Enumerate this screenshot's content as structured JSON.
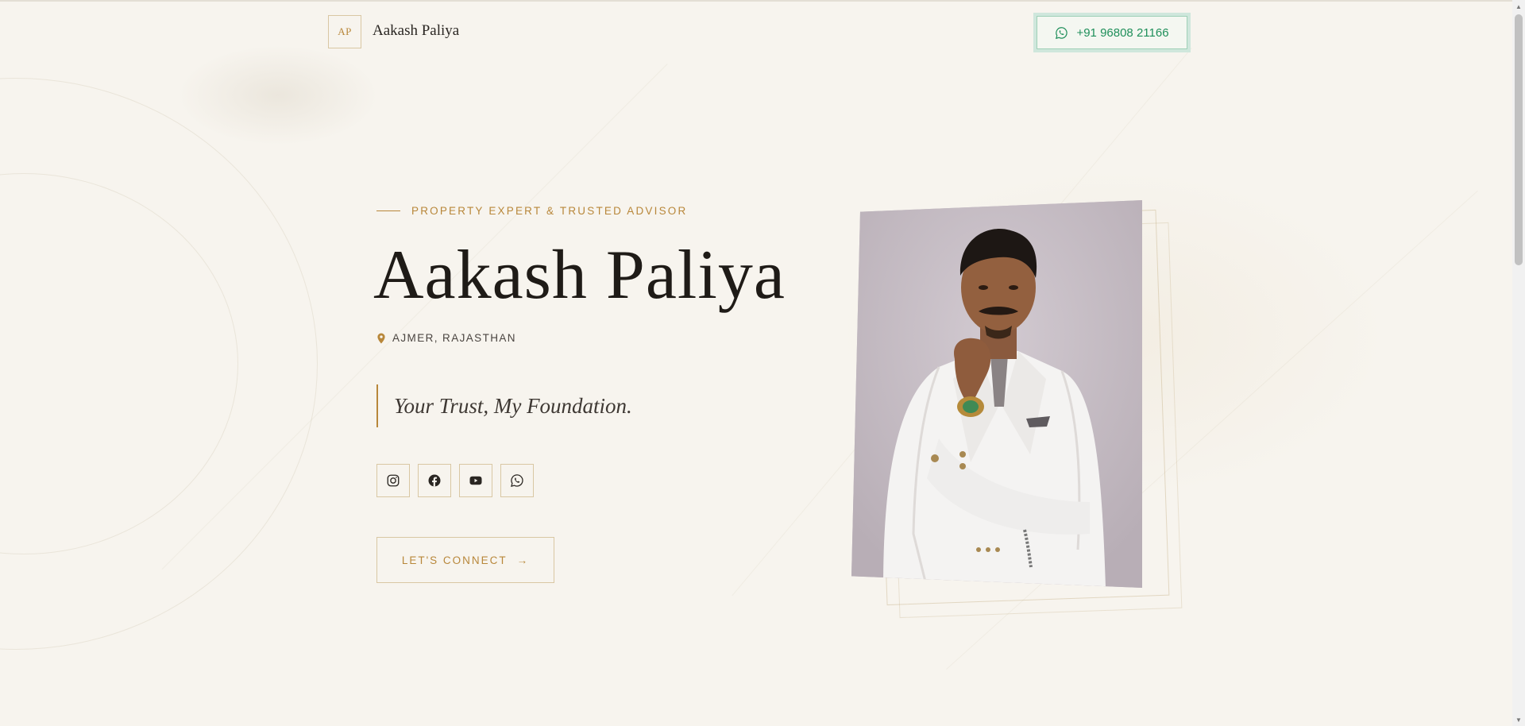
{
  "header": {
    "logo_initials": "AP",
    "logo_name": "Aakash Paliya",
    "phone_label": "+91 96808 21166"
  },
  "hero": {
    "eyebrow": "PROPERTY EXPERT & TRUSTED ADVISOR",
    "name": "Aakash Paliya",
    "location": "AJMER, RAJASTHAN",
    "tagline": "Your Trust, My Foundation.",
    "cta_label": "LET'S CONNECT",
    "cta_arrow": "→"
  },
  "socials": [
    {
      "icon": "instagram-icon"
    },
    {
      "icon": "facebook-icon"
    },
    {
      "icon": "youtube-icon"
    },
    {
      "icon": "whatsapp-icon"
    }
  ],
  "colors": {
    "background": "#f7f4ee",
    "accent_gold": "#b8873a",
    "whatsapp_green": "#1f8f5a",
    "text_dark": "#1f1b17"
  },
  "scrollbar": {
    "up_arrow": "▲",
    "down_arrow": "▼"
  }
}
